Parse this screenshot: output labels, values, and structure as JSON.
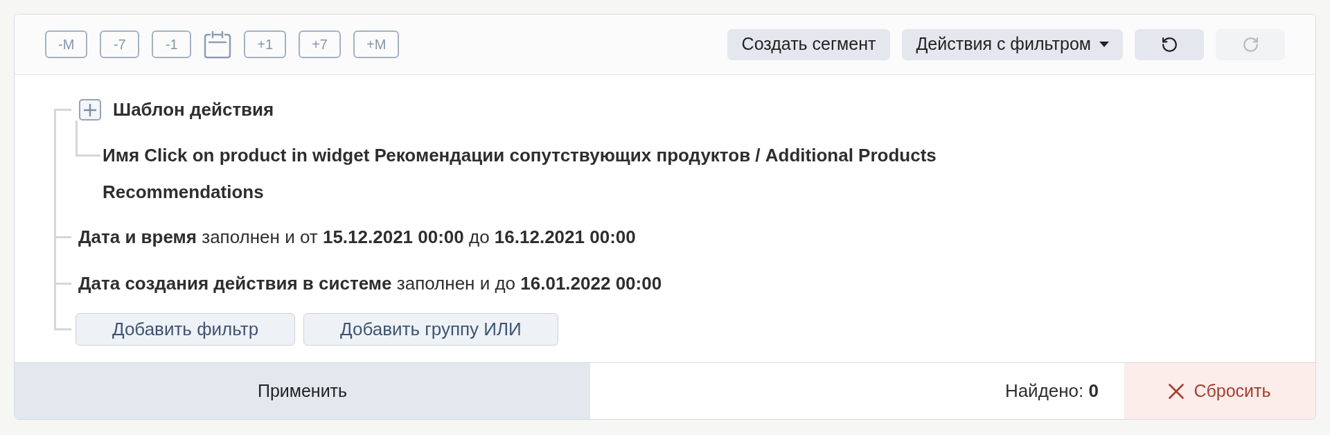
{
  "toolbar": {
    "date_buttons": [
      {
        "kind": "shift",
        "label": "-M"
      },
      {
        "kind": "shift",
        "label": "-7"
      },
      {
        "kind": "shift",
        "label": "-1"
      },
      {
        "kind": "calendar"
      },
      {
        "kind": "shift",
        "label": "+1"
      },
      {
        "kind": "shift",
        "label": "+7"
      },
      {
        "kind": "shift",
        "label": "+M"
      }
    ],
    "actions": [
      {
        "kind": "text",
        "label": "Создать сегмент",
        "disabled": false
      },
      {
        "kind": "dropdown",
        "label": "Действия с фильтром",
        "disabled": false
      },
      {
        "kind": "undo",
        "disabled": false
      },
      {
        "kind": "redo",
        "disabled": true
      }
    ]
  },
  "filter_tree": {
    "items": [
      {
        "kind": "group",
        "title": "Шаблон действия",
        "children": [
          {
            "kind": "value",
            "text": "Имя Click on product in widget Рекомендации сопутствующих продуктов / Additional Products Recommendations"
          }
        ]
      },
      {
        "kind": "condition",
        "text": "**Дата и время** заполнен и от **15.12.2021 00:00** до **16.12.2021 00:00**"
      },
      {
        "kind": "condition",
        "text": "**Дата создания действия в системе** заполнен и до **16.01.2022 00:00**"
      }
    ],
    "add_buttons": [
      "Добавить фильтр",
      "Добавить группу ИЛИ"
    ]
  },
  "footer": {
    "apply": "Применить",
    "found": "Найдено: **0**",
    "reset": "Сбросить"
  }
}
